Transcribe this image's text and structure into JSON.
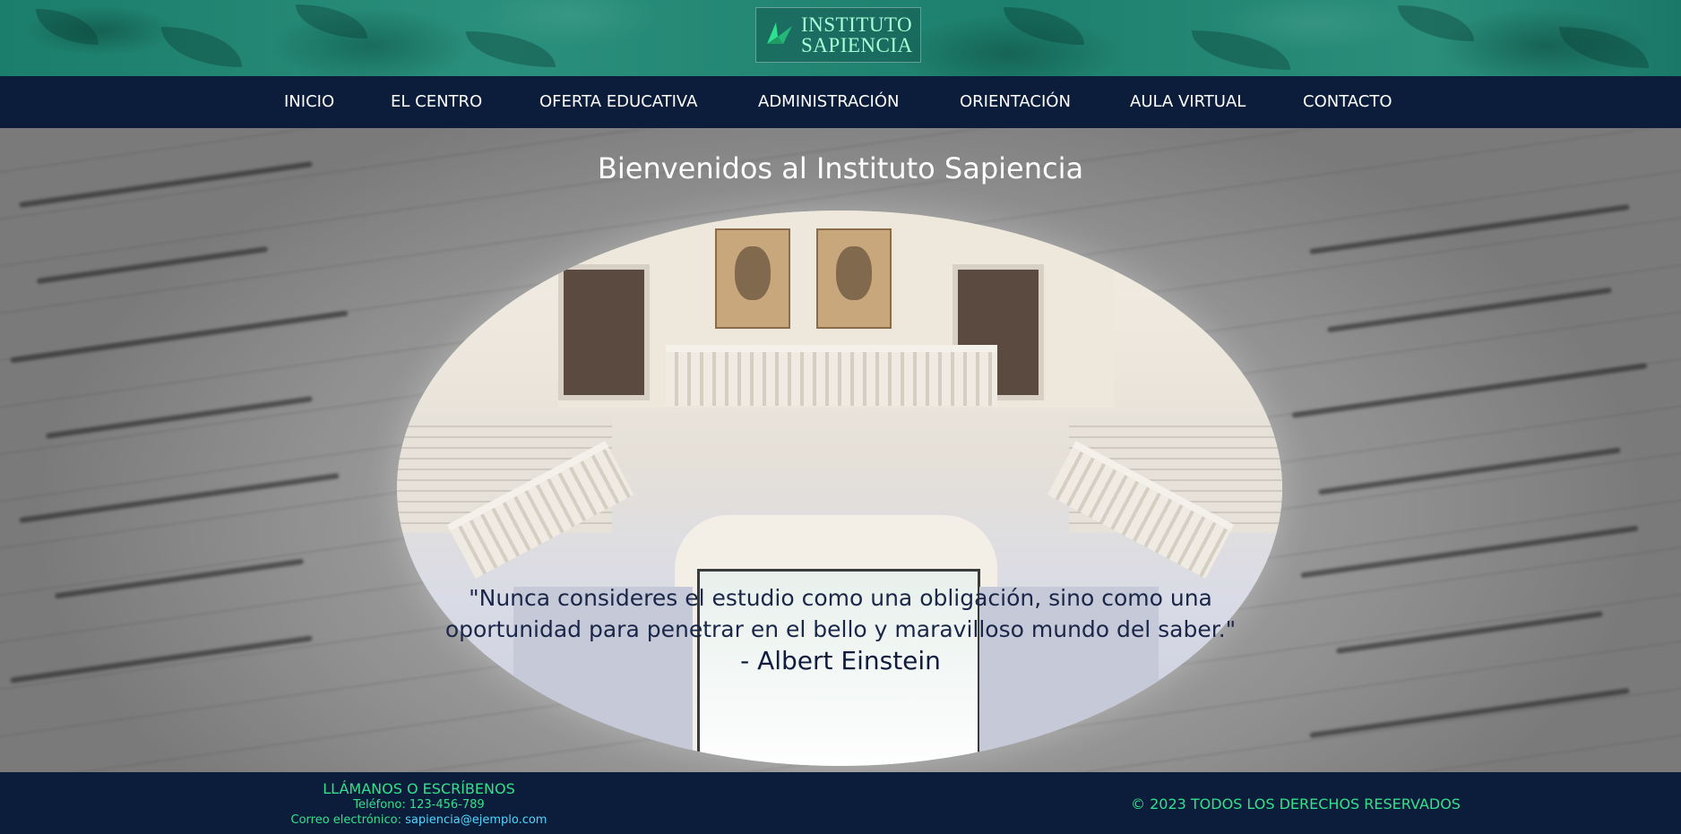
{
  "header": {
    "logo": {
      "line1": "INSTITUTO",
      "line2": "SAPIENCIA",
      "icon": "leaf-logo-icon"
    }
  },
  "nav": {
    "items": [
      {
        "label": "INICIO"
      },
      {
        "label": "EL CENTRO"
      },
      {
        "label": "OFERTA EDUCATIVA"
      },
      {
        "label": "ADMINISTRACIÓN"
      },
      {
        "label": "ORIENTACIÓN"
      },
      {
        "label": "AULA VIRTUAL"
      },
      {
        "label": "CONTACTO"
      }
    ]
  },
  "hero": {
    "title": "Bienvenidos al Instituto Sapiencia",
    "quote_line1": "\"Nunca consideres el estudio como una obligación, sino como una",
    "quote_line2": "oportunidad para penetrar en el bello y maravilloso mundo del saber.\"",
    "author": "- Albert Einstein"
  },
  "footer": {
    "contact_heading": "LLÁMANOS O ESCRÍBENOS",
    "phone": "Teléfono: 123-456-789",
    "email_label": "Correo electrónico: ",
    "email": "sapiencia@ejemplo.com",
    "copyright": "© 2023 TODOS LOS DERECHOS RESERVADOS"
  },
  "colors": {
    "nav_bg": "#0b1d3a",
    "header_teal": "#1b7d6b",
    "footer_green": "#34e08a",
    "link_cyan": "#4fd7ff",
    "quote_text": "#1a2748"
  }
}
